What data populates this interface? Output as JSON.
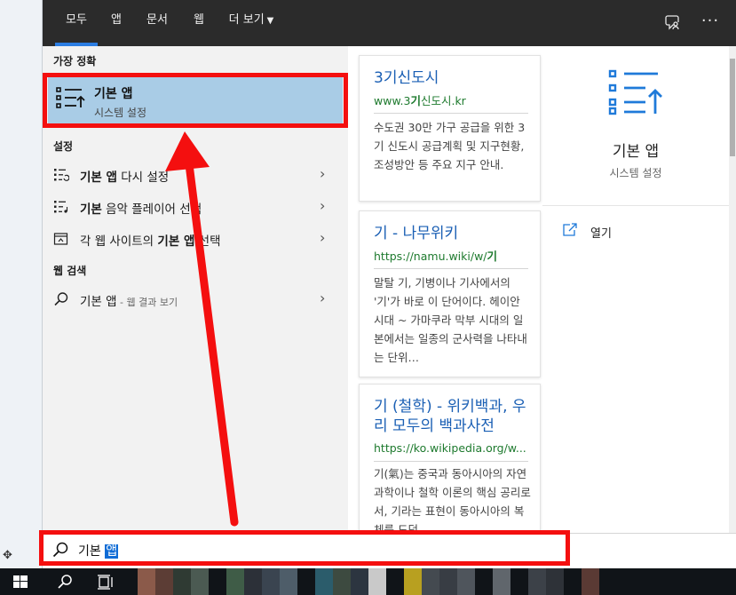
{
  "tabs": [
    {
      "label": "모두",
      "active": true
    },
    {
      "label": "앱"
    },
    {
      "label": "문서"
    },
    {
      "label": "웹"
    },
    {
      "label": "더 보기"
    }
  ],
  "top_icons": {
    "feedback": "feedback-icon",
    "more": "···"
  },
  "best_match": {
    "heading": "가장 정확",
    "title": "기본 앱",
    "subtitle": "시스템 설정",
    "icon": "default-apps-icon"
  },
  "settings": {
    "heading": "설정",
    "items": [
      {
        "bold": "기본 앱",
        "rest": " 다시 설정",
        "icon": "reset-list-icon"
      },
      {
        "pre": "기본",
        "rest": " 음악 플레이어 선택",
        "icon": "music-list-icon"
      },
      {
        "pre": "각 웹 사이트의 ",
        "bold": "기본 앱",
        "rest": " 선택",
        "icon": "web-app-icon"
      }
    ]
  },
  "web_search": {
    "heading": "웹 검색",
    "item": {
      "query": "기본 앱",
      "suffix": " - 웹 결과 보기",
      "icon": "search-icon"
    }
  },
  "cards": [
    {
      "title": "3기신도시",
      "url_prefix": "www.3",
      "url_bold": "기",
      "url_suffix": "신도시.kr",
      "body": "수도권 30만 가구 공급을 위한 3기 신도시 공급계획 및 지구현황, 조성방안 등 주요 지구 안내."
    },
    {
      "title": "기 - 나무위키",
      "url_prefix": "https://namu.wiki/w/",
      "url_bold": "기",
      "url_suffix": "",
      "body": "말탈 기, 기병이나 기사에서의 '기'가 바로 이 단어이다. 헤이안 시대 ~ 가마쿠라 막부 시대의 일본에서는 일종의 군사력을 나타내는 단위…"
    },
    {
      "title": "기 (철학) - 위키백과, 우리 모두의 백과사전",
      "url_prefix": "https://ko.wikipedia.org/w...",
      "url_bold": "",
      "url_suffix": "",
      "body": "기(氣)는 중국과 동아시아의 자연과학이나 철학 이론의 핵심 공리로서, 기라는 표현이 동아시아의 복체를 도덕"
    }
  ],
  "detail": {
    "title": "기본 앱",
    "subtitle": "시스템 설정",
    "open_label": "열기",
    "icon": "default-apps-icon"
  },
  "search": {
    "typed": "기본 ",
    "selected": "앱"
  },
  "taskbar": {
    "start": "windows-start-icon",
    "search": "search-icon",
    "task_view": "task-view-icon"
  },
  "colors": {
    "accent": "#2b7de2",
    "selection": "#a9cce6",
    "annotation": "#f40f0f",
    "link": "#1a5fb4",
    "url": "#1e7a2e"
  }
}
